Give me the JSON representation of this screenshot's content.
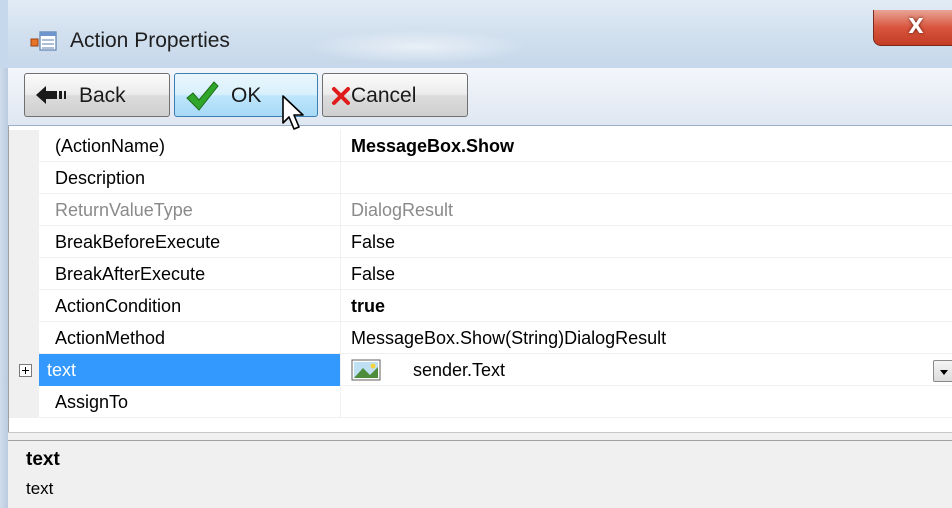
{
  "window": {
    "title": "Action Properties",
    "close_glyph": "X",
    "icon": "properties-window-icon"
  },
  "toolbar": {
    "back_label": "Back",
    "ok_label": "OK",
    "cancel_label": "Cancel",
    "back_icon": "back-arrow-icon",
    "ok_icon": "checkmark-icon",
    "cancel_icon": "red-x-icon"
  },
  "properties": {
    "rows": [
      {
        "name": "(ActionName)",
        "value": "MessageBox.Show"
      },
      {
        "name": "Description",
        "value": ""
      },
      {
        "name": "ReturnValueType",
        "value": "DialogResult"
      },
      {
        "name": "BreakBeforeExecute",
        "value": "False"
      },
      {
        "name": "BreakAfterExecute",
        "value": "False"
      },
      {
        "name": "ActionCondition",
        "value": "true"
      },
      {
        "name": "ActionMethod",
        "value": "MessageBox.Show(String)DialogResult"
      },
      {
        "name": "text",
        "value": "sender.Text"
      },
      {
        "name": "AssignTo",
        "value": ""
      }
    ]
  },
  "description_pane": {
    "title": "text",
    "text": "text"
  },
  "colors": {
    "selection": "#3399ff",
    "readonly_text": "#8a8a8a",
    "close_button": "#d8553e"
  }
}
